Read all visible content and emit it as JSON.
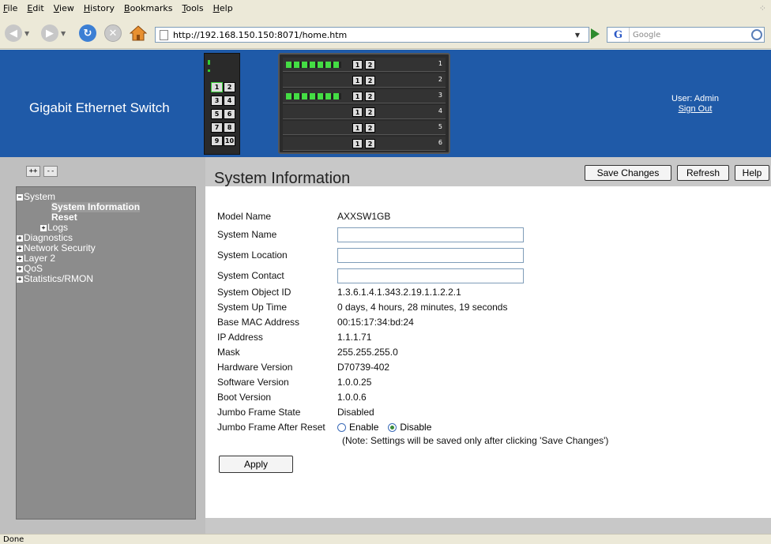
{
  "browser": {
    "menu": [
      "File",
      "Edit",
      "View",
      "History",
      "Bookmarks",
      "Tools",
      "Help"
    ],
    "url": "http://192.168.150.150:8071/home.htm",
    "search_placeholder": "Google",
    "status": "Done"
  },
  "header": {
    "brand": "Gigabit Ethernet Switch",
    "user_label": "User: Admin",
    "signout_label": "Sign Out",
    "small_switch_ports": [
      "1",
      "2",
      "3",
      "4",
      "5",
      "6",
      "7",
      "8",
      "9",
      "10"
    ],
    "big_switch_rows": [
      "1",
      "2",
      "3",
      "4",
      "5",
      "6"
    ],
    "big_switch_port_labels": [
      "1",
      "2"
    ]
  },
  "sidebar": {
    "expand_all": "++",
    "collapse_all": "--",
    "tree": [
      {
        "label": "System",
        "sign": "−",
        "level": 0
      },
      {
        "label": "System Information",
        "level": 2,
        "selected": true
      },
      {
        "label": "Reset",
        "level": 2,
        "bold": true
      },
      {
        "label": "Logs",
        "sign": "+",
        "level": 1
      },
      {
        "label": "Diagnostics",
        "sign": "+",
        "level": 0
      },
      {
        "label": "Network Security",
        "sign": "+",
        "level": 0
      },
      {
        "label": "Layer 2",
        "sign": "+",
        "level": 0
      },
      {
        "label": "QoS",
        "sign": "+",
        "level": 0
      },
      {
        "label": "Statistics/RMON",
        "sign": "+",
        "level": 0
      }
    ]
  },
  "main": {
    "title": "System Information",
    "buttons": {
      "save": "Save Changes",
      "refresh": "Refresh",
      "help": "Help"
    },
    "fields": {
      "model_name": {
        "label": "Model Name",
        "value": "AXXSW1GB"
      },
      "system_name": {
        "label": "System Name",
        "value": ""
      },
      "system_location": {
        "label": "System Location",
        "value": ""
      },
      "system_contact": {
        "label": "System Contact",
        "value": ""
      },
      "object_id": {
        "label": "System Object ID",
        "value": "1.3.6.1.4.1.343.2.19.1.1.2.2.1"
      },
      "up_time": {
        "label": "System Up Time",
        "value": "0 days, 4 hours, 28 minutes, 19 seconds"
      },
      "mac": {
        "label": "Base MAC Address",
        "value": "00:15:17:34:bd:24"
      },
      "ip": {
        "label": "IP Address",
        "value": "1.1.1.71"
      },
      "mask": {
        "label": "Mask",
        "value": "255.255.255.0"
      },
      "hw": {
        "label": "Hardware Version",
        "value": "D70739-402"
      },
      "sw": {
        "label": "Software Version",
        "value": "1.0.0.25"
      },
      "boot": {
        "label": "Boot Version",
        "value": "1.0.0.6"
      },
      "jumbo_state": {
        "label": "Jumbo Frame State",
        "value": "Disabled"
      },
      "jumbo_after": {
        "label": "Jumbo Frame After Reset",
        "enable": "Enable",
        "disable": "Disable",
        "selected": "Disable"
      }
    },
    "note": "(Note: Settings will be saved only after clicking 'Save Changes')",
    "apply": "Apply"
  },
  "colors": {
    "header_bg": "#1f5aa8",
    "tree_bg": "#8c8c8c",
    "panel_bg": "#c8c8c8"
  }
}
